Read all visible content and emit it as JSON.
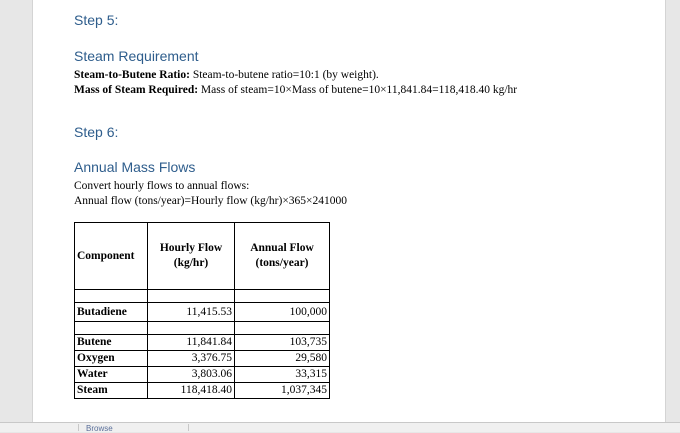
{
  "step5": {
    "heading": "Step 5:",
    "subheading": "Steam Requirement",
    "ratio_label": "Steam-to-Butene Ratio:",
    "ratio_text": "Steam-to-butene ratio=10:1 (by weight).",
    "mass_label": "Mass of Steam Required:",
    "mass_text": "Mass of steam=10×Mass of butene=10×11,841.84=118,418.40 kg/hr"
  },
  "step6": {
    "heading": "Step 6:",
    "subheading": "Annual Mass Flows",
    "intro": "Convert hourly flows to annual flows:",
    "formula": "Annual flow (tons/year)=Hourly flow (kg/hr)×365×241000"
  },
  "table": {
    "headers": {
      "component": "Component",
      "hourly_line1": "Hourly Flow",
      "hourly_line2": "(kg/hr)",
      "annual_line1": "Annual Flow",
      "annual_line2": "(tons/year)"
    },
    "rows": [
      {
        "component": "Butadiene",
        "hourly": "11,415.53",
        "annual": "100,000"
      },
      {
        "component": "Butene",
        "hourly": "11,841.84",
        "annual": "103,735"
      },
      {
        "component": "Oxygen",
        "hourly": "3,376.75",
        "annual": "29,580"
      },
      {
        "component": "Water",
        "hourly": "3,803.06",
        "annual": "33,315"
      },
      {
        "component": "Steam",
        "hourly": "118,418.40",
        "annual": "1,037,345"
      }
    ]
  },
  "footer": {
    "tab_label": "Browse"
  }
}
